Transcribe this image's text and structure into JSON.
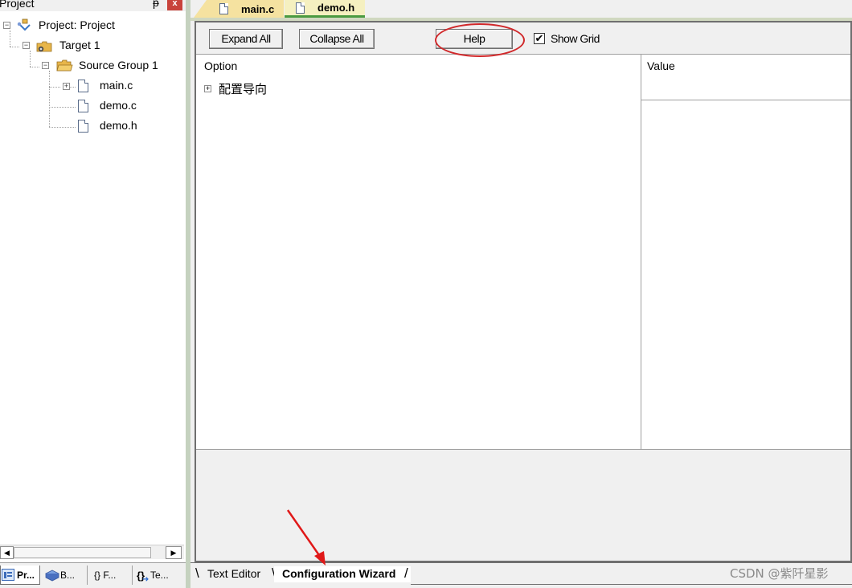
{
  "project_panel": {
    "title": "Project",
    "pin_glyph": "ᵽ",
    "close_glyph": "x",
    "tree": [
      {
        "label": "Project: Project",
        "icon": "project-icon"
      },
      {
        "label": "Target 1",
        "icon": "target-folder-icon"
      },
      {
        "label": "Source Group 1",
        "icon": "folder-icon"
      },
      {
        "label": "main.c",
        "icon": "file-icon"
      },
      {
        "label": "demo.c",
        "icon": "file-icon"
      },
      {
        "label": "demo.h",
        "icon": "file-icon"
      }
    ],
    "bottom_tabs": [
      {
        "label": "Pr...",
        "icon": "project-tab-icon"
      },
      {
        "label": "B...",
        "icon": "books-tab-icon"
      },
      {
        "label": "{} F...",
        "icon": "functions-tab-icon"
      },
      {
        "label": "Te...",
        "icon": "templates-tab-icon"
      }
    ]
  },
  "file_tabs": [
    {
      "label": "main.c",
      "active": false
    },
    {
      "label": "demo.h",
      "active": true
    }
  ],
  "wizard": {
    "expand_all_label": "Expand All",
    "collapse_all_label": "Collapse All",
    "help_label": "Help",
    "show_grid_label": "Show Grid",
    "show_grid_checked": true,
    "check_glyph": "✔",
    "option_header": "Option",
    "value_header": "Value",
    "options": [
      {
        "label": "配置导向",
        "expander": "⊞"
      }
    ]
  },
  "editor_tabs": [
    {
      "label": "Text Editor",
      "active": false
    },
    {
      "label": "Configuration Wizard",
      "active": true
    }
  ],
  "watermark": "CSDN @紫阡星影",
  "colors": {
    "annotation_red": "#d0282a",
    "active_tab_underline": "#4a9a40",
    "main_tab_bg": "#f5e2a0"
  }
}
